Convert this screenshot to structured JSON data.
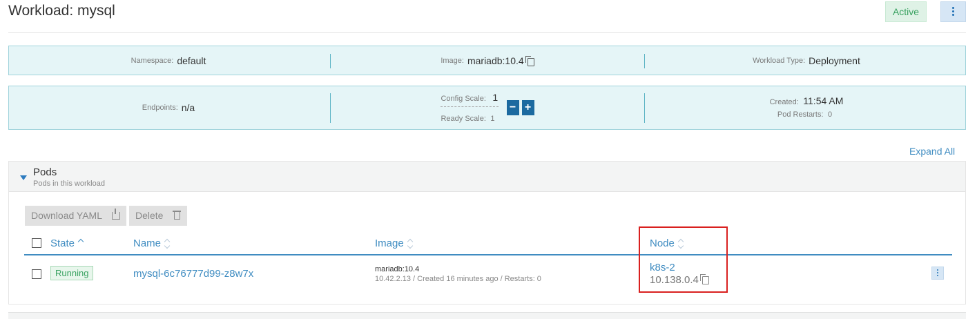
{
  "header": {
    "title": "Workload: mysql",
    "state": "Active"
  },
  "info_row1": {
    "namespace_label": "Namespace:",
    "namespace_value": "default",
    "image_label": "Image:",
    "image_value": "mariadb:10.4",
    "type_label": "Workload Type:",
    "type_value": "Deployment"
  },
  "info_row2": {
    "endpoints_label": "Endpoints:",
    "endpoints_value": "n/a",
    "config_scale_label": "Config Scale:",
    "config_scale_value": "1",
    "ready_scale_label": "Ready Scale:",
    "ready_scale_value": "1",
    "decrement": "−",
    "increment": "+",
    "created_label": "Created:",
    "created_value": "11:54 AM",
    "restarts_label": "Pod Restarts:",
    "restarts_value": "0"
  },
  "expand_all": "Expand All",
  "pods": {
    "title": "Pods",
    "subtitle": "Pods in this workload",
    "download_label": "Download YAML",
    "delete_label": "Delete",
    "columns": {
      "state": "State",
      "name": "Name",
      "image": "Image",
      "node": "Node"
    },
    "rows": [
      {
        "state": "Running",
        "name": "mysql-6c76777d99-z8w7x",
        "image": "mariadb:10.4",
        "meta": "10.42.2.13 / Created 16 minutes ago / Restarts: 0",
        "node": "k8s-2",
        "node_ip": "10.138.0.4"
      }
    ]
  },
  "icons": [
    "kebab-icon",
    "copy-icon",
    "caret-down-icon",
    "download-icon",
    "trash-icon",
    "sort-icon",
    "checkbox"
  ],
  "colors": {
    "accent": "#3f8cc1",
    "info_bg": "#e5f5f7",
    "info_border": "#9fd3db",
    "active": "#3aa261",
    "highlight": "#d9201f"
  }
}
